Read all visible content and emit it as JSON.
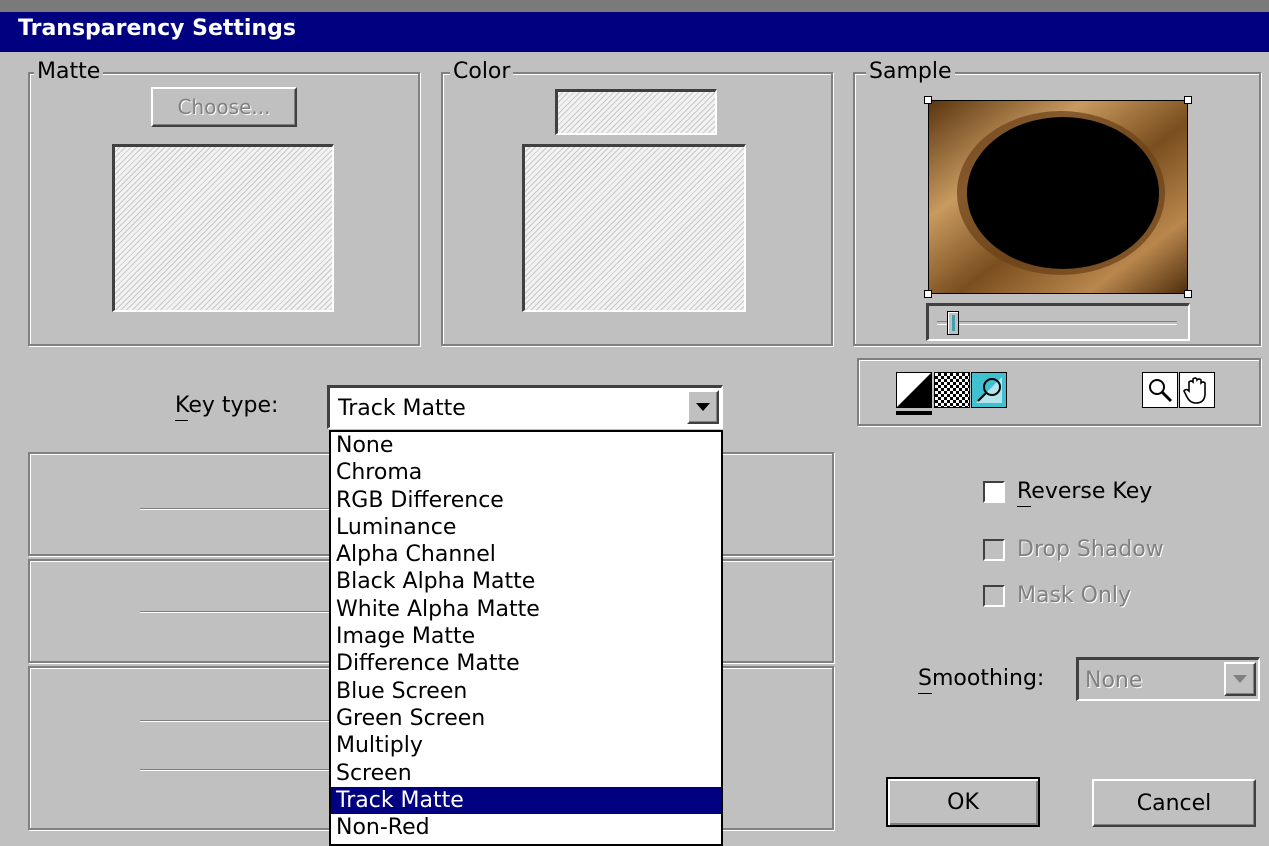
{
  "dialog": {
    "title": "Transparency Settings"
  },
  "matte": {
    "label": "Matte",
    "choose_button": "Choose..."
  },
  "color": {
    "label": "Color"
  },
  "sample": {
    "label": "Sample",
    "slider_value": 0.05,
    "view_icons": [
      "black-white-toggle-icon",
      "checkerboard-icon",
      "matte-icon"
    ],
    "tool_icons": [
      "zoom-icon",
      "hand-icon"
    ]
  },
  "key_type": {
    "label": "Key type:",
    "selected": "Track Matte",
    "options": [
      "None",
      "Chroma",
      "RGB Difference",
      "Luminance",
      "Alpha Channel",
      "Black Alpha Matte",
      "White Alpha Matte",
      "Image Matte",
      "Difference Matte",
      "Blue Screen",
      "Green Screen",
      "Multiply",
      "Screen",
      "Track Matte",
      "Non-Red"
    ]
  },
  "options": {
    "reverse_key": "Reverse Key",
    "drop_shadow": "Drop Shadow",
    "mask_only": "Mask Only"
  },
  "smoothing": {
    "label": "Smoothing:",
    "value": "None"
  },
  "buttons": {
    "ok": "OK",
    "cancel": "Cancel"
  }
}
